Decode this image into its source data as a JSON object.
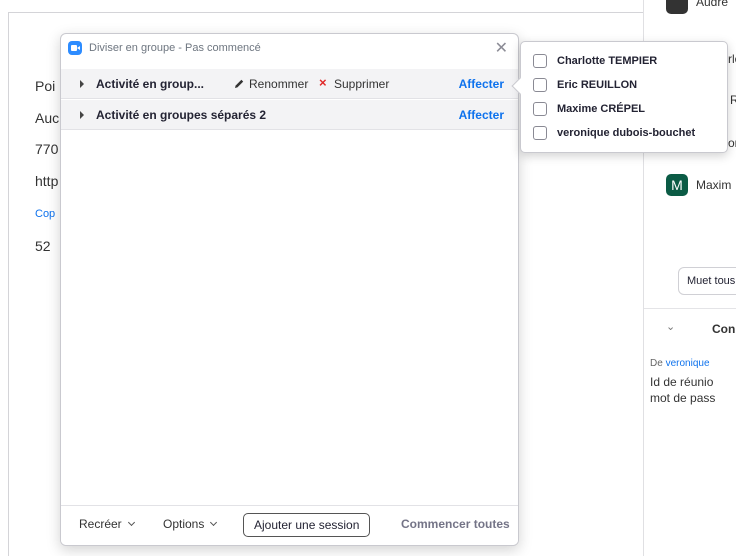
{
  "background": {
    "lines": [
      "Poi",
      "Auc",
      "770",
      "http",
      "Cop",
      "52"
    ]
  },
  "right_panel": {
    "top_name": "Audre",
    "partial_1": "rlo",
    "partial_2": "R",
    "partial_3": "on",
    "avatar_letter": "M",
    "avatar_name": "Maxim",
    "mute_all": "Muet tous",
    "chat_header": "Con",
    "from_prefix": "De",
    "from_name": "veronique",
    "msg_line1": "Id de réunio",
    "msg_line2": "mot de pass"
  },
  "dialog": {
    "title": "Diviser en groupe - Pas commencé",
    "rooms": [
      {
        "name": "Activité en group...",
        "rename": "Renommer",
        "delete": "Supprimer",
        "assign": "Affecter"
      },
      {
        "name": "Activité en groupes séparés 2",
        "assign": "Affecter"
      }
    ],
    "footer": {
      "recreate": "Recréer",
      "options": "Options",
      "add_session": "Ajouter une session",
      "start_all": "Commencer toutes"
    }
  },
  "participants_popup": {
    "items": [
      "Charlotte TEMPIER",
      "Eric REUILLON",
      "Maxime CRÉPEL",
      "veronique dubois-bouchet"
    ]
  },
  "colors": {
    "accent": "#0e72ed",
    "delete": "#e02828",
    "avatar_green": "#0b5b45",
    "avatar_purple": "#6b3fa0"
  }
}
